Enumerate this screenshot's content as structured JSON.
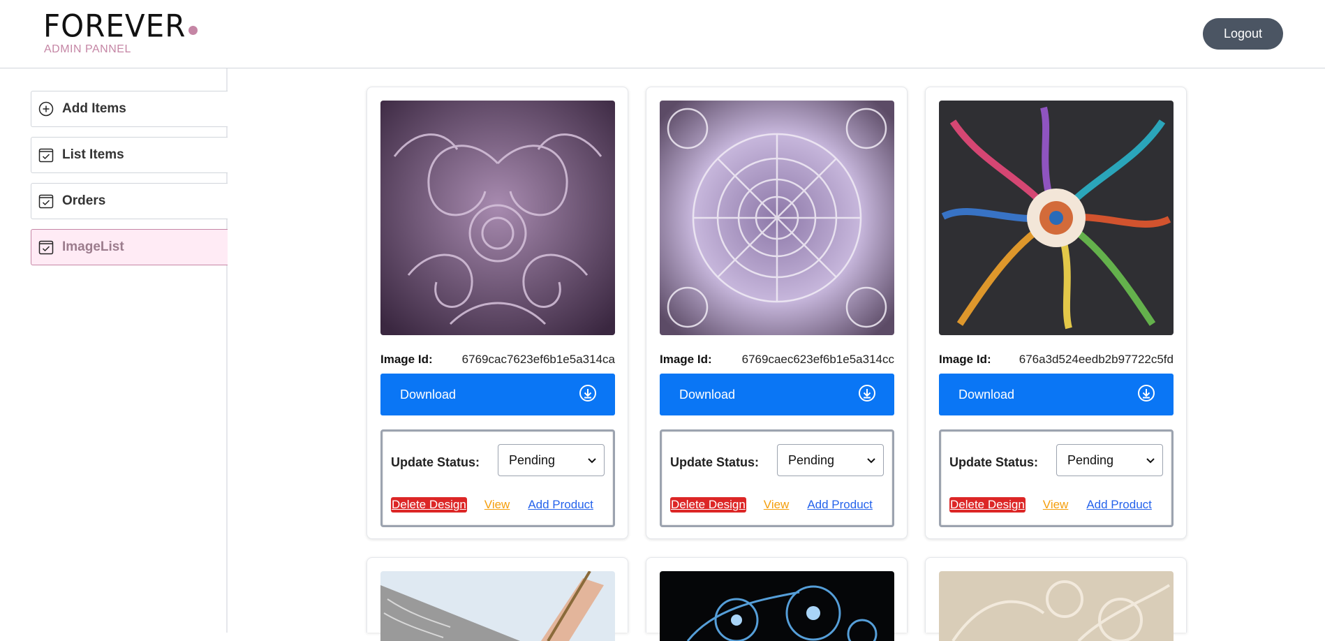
{
  "header": {
    "logo_text": "FOREVER",
    "logo_subtitle": "ADMIN PANNEL",
    "logout_label": "Logout"
  },
  "sidebar": {
    "items": [
      {
        "label": "Add Items",
        "icon": "plus-circle-icon"
      },
      {
        "label": "List Items",
        "icon": "checkbox-icon"
      },
      {
        "label": "Orders",
        "icon": "checkbox-icon"
      },
      {
        "label": "ImageList",
        "icon": "checkbox-icon",
        "active": true
      }
    ]
  },
  "cards": [
    {
      "image_id_label": "Image Id:",
      "image_id": "6769cac7623ef6b1e5a314ca",
      "download_label": "Download",
      "status_label": "Update Status:",
      "status_value": "Pending",
      "delete_label": "Delete Design",
      "view_label": "View",
      "add_product_label": "Add Product"
    },
    {
      "image_id_label": "Image Id:",
      "image_id": "6769caec623ef6b1e5a314cc",
      "download_label": "Download",
      "status_label": "Update Status:",
      "status_value": "Pending",
      "delete_label": "Delete Design",
      "view_label": "View",
      "add_product_label": "Add Product"
    },
    {
      "image_id_label": "Image Id:",
      "image_id": "676a3d524eedb2b97722c5fd",
      "download_label": "Download",
      "status_label": "Update Status:",
      "status_value": "Pending",
      "delete_label": "Delete Design",
      "view_label": "View",
      "add_product_label": "Add Product"
    }
  ],
  "colors": {
    "accent": "#0a76f5",
    "brand_pink": "#c586a5",
    "active_bg": "#ffebf5",
    "delete_red": "#dc2626",
    "view_orange": "#f59e0b",
    "link_blue": "#2563eb"
  }
}
